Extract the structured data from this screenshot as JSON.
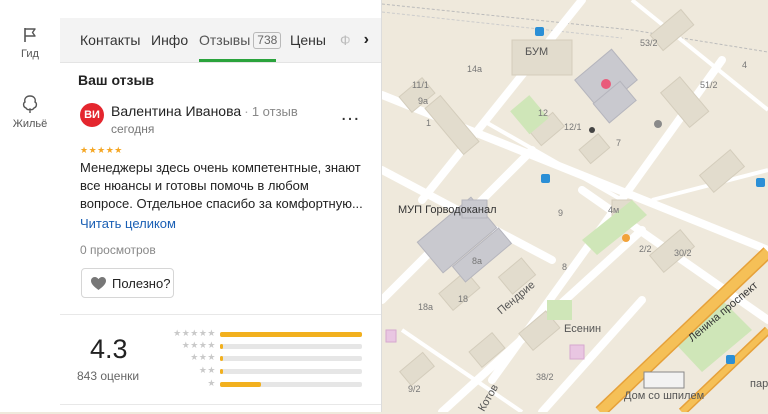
{
  "rail": {
    "guide_label": "Гид",
    "housing_label": "Жильё"
  },
  "tabs": [
    {
      "label": "Контакты"
    },
    {
      "label": "Инфо"
    },
    {
      "label": "Отзывы",
      "count": "738"
    },
    {
      "label": "Цены"
    },
    {
      "label": "Ф"
    }
  ],
  "tab_more_icon": "chevron-right-icon",
  "review_section_title": "Ваш отзыв",
  "review": {
    "avatar_initials": "ВИ",
    "avatar_color": "#e4262e",
    "author": "Валентина Иванова",
    "author_reviews": "1 отзыв",
    "date": "сегодня",
    "stars": "★★★★★",
    "text_lines": [
      "Менеджеры здесь очень компетентные, знают",
      "все нюансы и готовы помочь в любом",
      "вопросе. Отдельное спасибо за комфортную..."
    ],
    "read_more": "Читать целиком",
    "views": "0 просмотров",
    "useful": "Полезно?"
  },
  "rating": {
    "value": "4.3",
    "count_label": "843 оценки",
    "distribution": [
      {
        "stars": "★★★★★",
        "fraction": 1.0
      },
      {
        "stars": "★★★★",
        "fraction": 0.02
      },
      {
        "stars": "★★★",
        "fraction": 0.02
      },
      {
        "stars": "★★",
        "fraction": 0.02
      },
      {
        "stars": "★",
        "fraction": 0.29
      }
    ]
  },
  "map": {
    "labels": [
      "БУМ",
      "МУП Горводоканал",
      "Пендрие",
      "Есенин",
      "Ленина проспект",
      "Дом со шпилем",
      "Котов",
      "пар"
    ],
    "house_numbers": [
      "53/2",
      "14а",
      "11/1",
      "9а",
      "12/1",
      "12",
      "51/2",
      "4м",
      "1",
      "9",
      "2/2",
      "30/2",
      "8а",
      "18",
      "18а",
      "8",
      "38/2",
      "9/2",
      "7",
      "4"
    ]
  },
  "colors": {
    "accent_green": "#2aa33c",
    "star_orange": "#f5a623",
    "bar_yellow": "#f2b01e",
    "link_blue": "#1a5fb4",
    "road_orange": "#f3b23c"
  }
}
